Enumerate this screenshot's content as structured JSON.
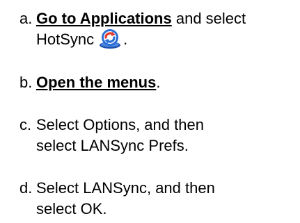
{
  "steps": [
    {
      "marker": "a.",
      "link": "Go to Applications",
      "text_after_link": " and select",
      "line2": "HotSync",
      "line2_suffix": ".",
      "icon": "hotsync-icon"
    },
    {
      "marker": "b.",
      "link": "Open the menus",
      "text_after_link": "."
    },
    {
      "marker": "c.",
      "text": "Select Options, and then",
      "line2": "select LANSync Prefs."
    },
    {
      "marker": "d.",
      "text": "Select LANSync, and then",
      "line2": "select OK."
    }
  ],
  "colors": {
    "text": "#000000",
    "icon_ring": "#2a6fd6",
    "icon_arrow": "#e23b2a",
    "icon_base": "#1d4fa8"
  }
}
